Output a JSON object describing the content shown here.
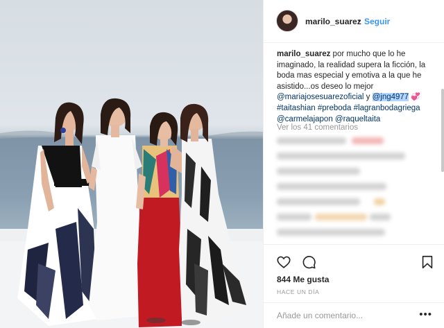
{
  "post": {
    "image_alt": "Four women in evening gowns posing on a terrace above the sea",
    "header": {
      "username": "marilo_suarez",
      "separator": "•",
      "follow_label": "Seguir"
    },
    "caption": {
      "username": "marilo_suarez",
      "text": " por mucho que lo he imaginado, la realidad supera la ficción, la boda mas especial y emotiva a la que he asistido...os deseo lo mejor ",
      "mention1": "@mariajosesuarezoficial",
      "joiner": " y ",
      "mention2": "@jng4977",
      "emoji": "💞",
      "tags": "#taitashian #preboda #lagranbodagriega",
      "mentions_line": "@carmelajapon @raqueltaita"
    },
    "view_all_comments": "Ver los 41 comentarios",
    "likes": "844 Me gusta",
    "time_ago": "HACE UN DÍA",
    "add_comment_placeholder": "Añade un comentario...",
    "more_label": "•••",
    "icons": {
      "like": "heart-outline-icon",
      "comment": "comment-bubble-icon",
      "save": "bookmark-icon",
      "more": "more-options-icon"
    },
    "colors": {
      "link": "#003569",
      "follow": "#3897f0",
      "muted": "#999999",
      "text": "#262626"
    }
  }
}
